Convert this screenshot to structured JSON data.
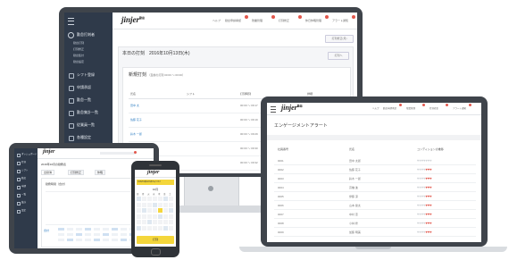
{
  "brand": {
    "logo": "jinjer",
    "logo_suffix": "勤怠"
  },
  "monitor": {
    "sidebar": {
      "section": "勤怠打刻者",
      "sub_items": [
        "勤怠打刻",
        "打刻修正",
        "勤怠集計",
        "勤怠設定"
      ],
      "items": [
        "シフト登録",
        "申請承認",
        "勤怠一覧",
        "勤怠集計一覧",
        "従業員一覧",
        "各種設定",
        "通知"
      ]
    },
    "header": {
      "nav": [
        "ヘルプ",
        "勤怠申請承認",
        "残業管理",
        "打刻修正",
        "休日休暇管理",
        "アラート通知"
      ]
    },
    "button": "打刻修正(月)",
    "panel_title": "本日の打刻　2016年10月13日(木)",
    "panel_link": "打刻へ",
    "card_title": "新規打刻",
    "card_subtitle": "（直前の打刻 00:00 ～ 00:00）",
    "columns": [
      "氏名",
      "シフト",
      "打刻時刻",
      "詳細"
    ],
    "rows": [
      {
        "name": "田中 太",
        "time": "00:00 ～ 09:17"
      },
      {
        "name": "佐藤 花子",
        "time": "00:00 ～ 09:19"
      },
      {
        "name": "鈴木 一郎",
        "time": "00:00 ～ 09:29"
      },
      {
        "name": "高橋 進",
        "time": "00:00 ～ 09:30"
      },
      {
        "name": "伊藤 涼",
        "time": "00:00 ～ 09:32"
      }
    ]
  },
  "laptop": {
    "header": {
      "nav": [
        "ヘルプ",
        "勤怠申請承認",
        "残業管理",
        "打刻修正",
        "アラート通知"
      ]
    },
    "title": "エンゲージメントアラート",
    "columns": [
      "社員番号",
      "氏名",
      "コンディションの推移"
    ],
    "rows": [
      {
        "id": "0001",
        "name": "田中 太郎",
        "hearts": 0
      },
      {
        "id": "0002",
        "name": "佐藤 花子",
        "hearts": 3
      },
      {
        "id": "0003",
        "name": "鈴木 一郎",
        "hearts": 3
      },
      {
        "id": "0004",
        "name": "高橋 進",
        "hearts": 3
      },
      {
        "id": "0005",
        "name": "伊藤 涼",
        "hearts": 3
      },
      {
        "id": "0006",
        "name": "山本 健太",
        "hearts": 3
      },
      {
        "id": "0007",
        "name": "中村 恵",
        "hearts": 3
      },
      {
        "id": "0008",
        "name": "小林 修",
        "hearts": 3
      },
      {
        "id": "0009",
        "name": "加藤 明美",
        "hearts": 3
      }
    ]
  },
  "tablet": {
    "sidebar": {
      "items": [
        "ダッシュボード",
        "打刻",
        "シフト",
        "勤怠",
        "申請",
        "一覧",
        "集計",
        "設定"
      ]
    },
    "title": "2016年10月の勤務表",
    "tabs": [
      "出勤簿",
      "打刻修正",
      "休暇"
    ],
    "subtitle": "勤務時間（合計）",
    "bottom_label": "合計"
  },
  "phone": {
    "alert": "未承認の勤怠申請があります",
    "month": "10月",
    "weekdays": [
      "日",
      "月",
      "火",
      "水",
      "木",
      "金",
      "土"
    ],
    "button": "打刻"
  },
  "colors": {
    "sidebar": "#2f3a4a",
    "device": "#3f444b",
    "accent": "#e2574c",
    "link": "#2f7ec2",
    "phone_yellow": "#f4d63b"
  }
}
